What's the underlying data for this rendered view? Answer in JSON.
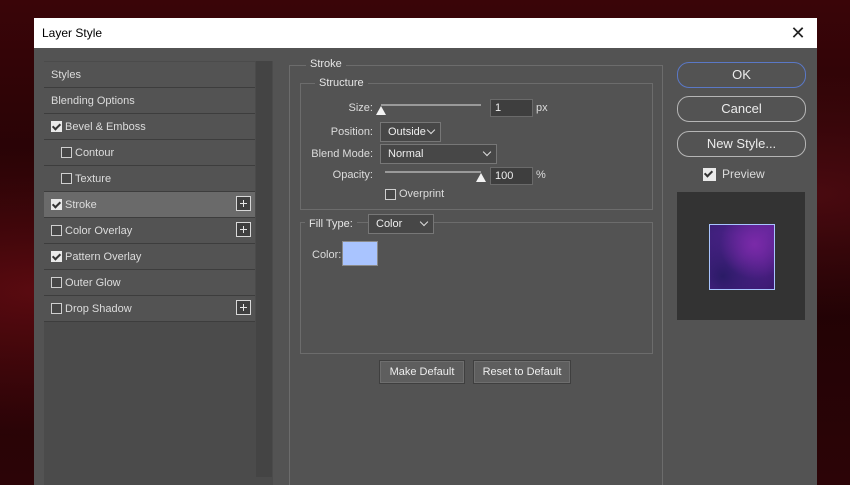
{
  "window": {
    "title": "Layer Style"
  },
  "styles_list": {
    "items": [
      {
        "label": "Styles",
        "type": "header"
      },
      {
        "label": "Blending Options",
        "type": "header"
      },
      {
        "label": "Bevel & Emboss",
        "checked": true,
        "indent": false,
        "plus": false
      },
      {
        "label": "Contour",
        "checked": false,
        "indent": true,
        "plus": false
      },
      {
        "label": "Texture",
        "checked": false,
        "indent": true,
        "plus": false
      },
      {
        "label": "Stroke",
        "checked": true,
        "indent": false,
        "plus": true,
        "selected": true
      },
      {
        "label": "Color Overlay",
        "checked": false,
        "indent": false,
        "plus": true
      },
      {
        "label": "Pattern Overlay",
        "checked": true,
        "indent": false,
        "plus": false
      },
      {
        "label": "Outer Glow",
        "checked": false,
        "indent": false,
        "plus": false
      },
      {
        "label": "Drop Shadow",
        "checked": false,
        "indent": false,
        "plus": true
      }
    ]
  },
  "stroke": {
    "group_title": "Stroke",
    "structure_title": "Structure",
    "size_label": "Size:",
    "size_value": "1",
    "size_unit": "px",
    "size_fraction": 0.0,
    "position_label": "Position:",
    "position_value": "Outside",
    "blend_mode_label": "Blend Mode:",
    "blend_mode_value": "Normal",
    "opacity_label": "Opacity:",
    "opacity_value": "100",
    "opacity_unit": "%",
    "opacity_fraction": 1.0,
    "overprint_label": "Overprint",
    "overprint_checked": false,
    "fill_type_label": "Fill Type:",
    "fill_type_value": "Color",
    "color_label": "Color:",
    "color_value": "#a9c4ff"
  },
  "buttons": {
    "make_default": "Make Default",
    "reset_default": "Reset to Default",
    "ok": "OK",
    "cancel": "Cancel",
    "new_style": "New Style..."
  },
  "preview": {
    "label": "Preview",
    "checked": true
  },
  "colors": {
    "dialog_bg": "#535353",
    "accent": "#5a78c6"
  }
}
